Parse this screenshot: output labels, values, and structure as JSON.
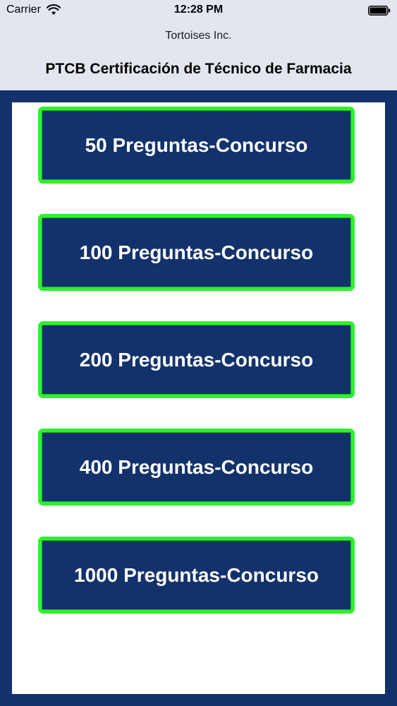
{
  "status_bar": {
    "carrier": "Carrier",
    "time": "12:28 PM",
    "icons": [
      "wifi-icon",
      "battery-icon"
    ]
  },
  "header": {
    "company": "Tortoises Inc.",
    "title": "PTCB Certificación de Técnico de Farmacia"
  },
  "quizzes": [
    {
      "label": "50 Preguntas-Concurso"
    },
    {
      "label": "100 Preguntas-Concurso"
    },
    {
      "label": "200 Preguntas-Concurso"
    },
    {
      "label": "400 Preguntas-Concurso"
    },
    {
      "label": "1000 Preguntas-Concurso"
    }
  ],
  "colors": {
    "background": "#13326c",
    "button_fill": "#13326c",
    "button_border": "#2cf22c",
    "header_bg": "#e3e6ef",
    "panel_bg": "#ffffff"
  }
}
